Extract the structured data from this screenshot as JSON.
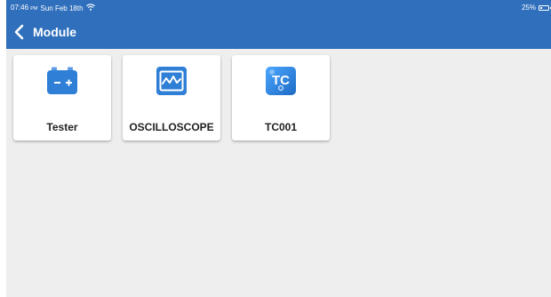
{
  "status_bar": {
    "time": "07:46",
    "ampm": "PM",
    "date": "Sun Feb 18th",
    "wifi_icon": "wifi-icon",
    "battery_percent": "25%",
    "battery_level": 0.25
  },
  "header": {
    "back_icon": "chevron-left-icon",
    "title": "Module"
  },
  "modules": [
    {
      "label": "Tester",
      "icon": "battery-tester-icon"
    },
    {
      "label": "OSCILLOSCOPE",
      "icon": "oscilloscope-icon"
    },
    {
      "label": "TC001",
      "icon": "tc001-logo-icon",
      "icon_text": "TC"
    }
  ],
  "colors": {
    "appbar": "#2f6fbc",
    "background": "#eeeeee",
    "icon_blue": "#2f7fd6"
  }
}
